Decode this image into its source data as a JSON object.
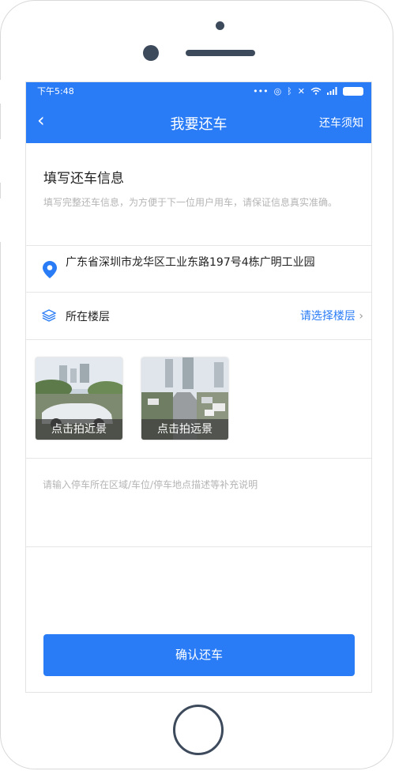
{
  "status_bar": {
    "time": "下午5:48",
    "icons": [
      "more-icon",
      "nfc-icon",
      "bluetooth-icon",
      "mute-icon",
      "wifi-icon",
      "signal-icon",
      "battery-icon"
    ]
  },
  "nav": {
    "title": "我要还车",
    "right_link": "还车须知"
  },
  "info": {
    "heading": "填写还车信息",
    "description": "填写完整还车信息，为方便于下一位用户用车，请保证信息真实准确。"
  },
  "address": {
    "text": "广东省深圳市龙华区工业东路197号4栋广明工业园"
  },
  "floor": {
    "label": "所在楼层",
    "select": "请选择楼层"
  },
  "photos": {
    "near_caption": "点击拍近景",
    "far_caption": "点击拍远景"
  },
  "note": {
    "placeholder": "请输入停车所在区域/车位/停车地点描述等补充说明"
  },
  "confirm_label": "确认还车",
  "colors": {
    "primary": "#2a7cf6",
    "placeholder": "#b5b5b5"
  }
}
